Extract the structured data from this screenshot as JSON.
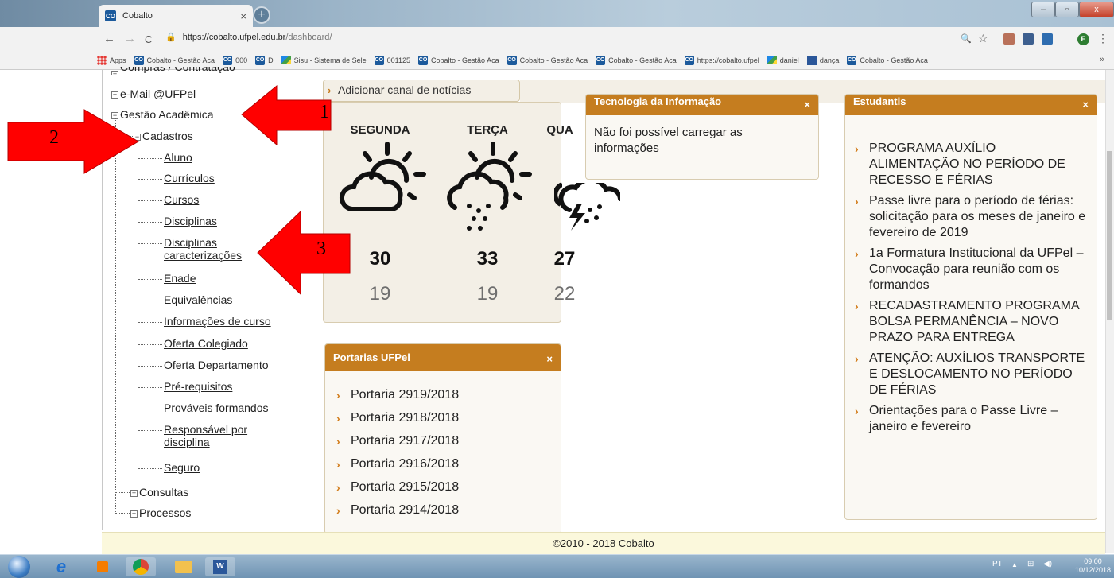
{
  "browser": {
    "tab_title": "Cobalto",
    "tab_close": "×",
    "new_tab": "+",
    "url_lock": "🔒",
    "url_host": "https://cobalto.ufpel.edu.br",
    "url_path": "/dashboard/",
    "back": "←",
    "forward": "→",
    "reload": "C",
    "avatar_letter": "E",
    "window_minimize": "–",
    "window_maximize": "▫",
    "window_close": "x",
    "zoom_icon": "🔍",
    "star_icon": "☆",
    "menu_icon": "⋮",
    "bookmarks_more": "»"
  },
  "bookmarks": [
    {
      "label": "Apps",
      "icon": "apps-icon"
    },
    {
      "label": "Cobalto - Gestão Aca",
      "icon": "cobalto-favicon"
    },
    {
      "label": "000",
      "icon": "cobalto-favicon"
    },
    {
      "label": "D",
      "icon": "cobalto-favicon"
    },
    {
      "label": "Sisu - Sistema de Sele",
      "icon": "flag-icon"
    },
    {
      "label": "001125",
      "icon": "cobalto-favicon"
    },
    {
      "label": "Cobalto - Gestão Aca",
      "icon": "cobalto-favicon"
    },
    {
      "label": "Cobalto - Gestão Aca",
      "icon": "cobalto-favicon"
    },
    {
      "label": "Cobalto - Gestão Aca",
      "icon": "cobalto-favicon"
    },
    {
      "label": "https://cobalto.ufpel",
      "icon": "cobalto-favicon"
    },
    {
      "label": "daniel",
      "icon": "flag-icon"
    },
    {
      "label": "dança",
      "icon": "word-icon"
    },
    {
      "label": "Cobalto - Gestão Aca",
      "icon": "cobalto-favicon"
    }
  ],
  "tree": {
    "top_item": "Compras / Contratação",
    "email": "e-Mail @UFPel",
    "gestao": "Gestão Acadêmica",
    "cadastros": "Cadastros",
    "leaves": [
      "Aluno",
      "Currículos",
      "Cursos",
      "Disciplinas",
      "Disciplinas caracterizações",
      "Enade",
      "Equivalências",
      "Informações de curso",
      "Oferta Colegiado",
      "Oferta Departamento",
      "Pré-requisitos",
      "Prováveis formandos",
      "Responsável por disciplina",
      "Seguro"
    ],
    "consultas": "Consultas",
    "processos": "Processos",
    "expand_symbol": "+",
    "collapse_symbol": "−"
  },
  "news_button": {
    "label": "Adicionar canal de notícias",
    "arrow": "›"
  },
  "weather": {
    "days": [
      {
        "name": "SEGUNDA",
        "high": "30",
        "low": "19",
        "icon": "partly-cloudy-icon"
      },
      {
        "name": "TERÇA",
        "high": "33",
        "low": "19",
        "icon": "rain-sun-icon"
      },
      {
        "name": "QUA",
        "high": "27",
        "low": "22",
        "icon": "storm-icon"
      }
    ]
  },
  "panels": {
    "ti": {
      "title": "Tecnologia da Informação",
      "close": "×",
      "message": "Não foi possível carregar as informações"
    },
    "estudantis": {
      "title": "Estudantis",
      "close": "×",
      "items": [
        "PROGRAMA AUXÍLIO ALIMENTAÇÃO NO PERÍODO DE RECESSO E FÉRIAS",
        "Passe livre para o período de férias: solicitação para os meses de janeiro e fevereiro de 2019",
        "1a Formatura Institucional da UFPel – Convocação para reunião com os formandos",
        "RECADASTRAMENTO PROGRAMA BOLSA PERMANÊNCIA – NOVO PRAZO PARA ENTREGA",
        "ATENÇÃO: AUXÍLIOS TRANSPORTE E DESLOCAMENTO NO PERÍODO DE FÉRIAS",
        "Orientações para o Passe Livre – janeiro e fevereiro"
      ]
    },
    "portarias": {
      "title": "Portarias UFPel",
      "close": "×",
      "items": [
        "Portaria 2919/2018",
        "Portaria 2918/2018",
        "Portaria 2917/2018",
        "Portaria 2916/2018",
        "Portaria 2915/2018",
        "Portaria 2914/2018"
      ]
    },
    "bullet": "›"
  },
  "footer": {
    "text": "©2010 - 2018 Cobalto"
  },
  "annotations": {
    "arrow1": "1",
    "arrow2": "2",
    "arrow3": "3",
    "color": "#ff0000"
  },
  "taskbar": {
    "lang": "PT",
    "time": "09:00",
    "date": "10/12/2018",
    "tray_up": "▲"
  },
  "colors": {
    "panel_header": "#c57d1f",
    "bullet": "#d27c1a",
    "footer_bg": "#fbf8dc",
    "panel_bg": "#f3efe6"
  }
}
